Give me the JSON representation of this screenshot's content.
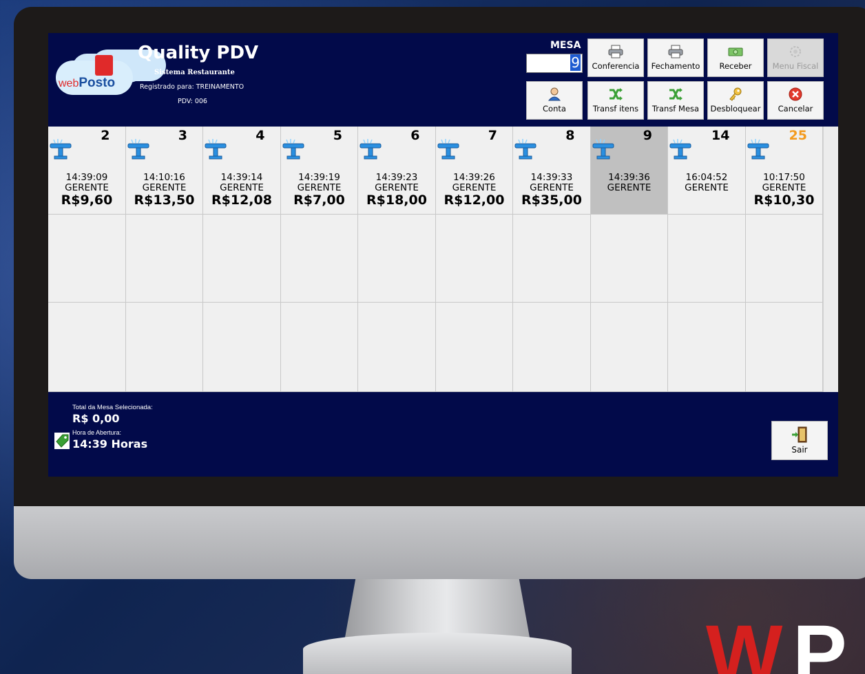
{
  "header": {
    "app_title": "Quality PDV",
    "subtitle": "Sistema Restaurante",
    "registered": "Registrado para: TREINAMENTO",
    "pdv": "PDV: 006",
    "logo_text_web": "web",
    "logo_text_posto": "Posto",
    "mesa_label": "MESA",
    "mesa_value": "9"
  },
  "toolbar": {
    "conferencia": "Conferencia",
    "fechamento": "Fechamento",
    "receber": "Receber",
    "menu_fiscal": "Menu Fiscal",
    "conta": "Conta",
    "transf_itens": "Transf itens",
    "transf_mesa": "Transf Mesa",
    "desbloquear": "Desbloquear",
    "cancelar": "Cancelar"
  },
  "tables": [
    {
      "number": "2",
      "time": "14:39:09",
      "user": "GERENTE",
      "value": "R$9,60"
    },
    {
      "number": "3",
      "time": "14:10:16",
      "user": "GERENTE",
      "value": "R$13,50"
    },
    {
      "number": "4",
      "time": "14:39:14",
      "user": "GERENTE",
      "value": "R$12,08"
    },
    {
      "number": "5",
      "time": "14:39:19",
      "user": "GERENTE",
      "value": "R$7,00"
    },
    {
      "number": "6",
      "time": "14:39:23",
      "user": "GERENTE",
      "value": "R$18,00"
    },
    {
      "number": "7",
      "time": "14:39:26",
      "user": "GERENTE",
      "value": "R$12,00"
    },
    {
      "number": "8",
      "time": "14:39:33",
      "user": "GERENTE",
      "value": "R$35,00"
    },
    {
      "number": "9",
      "time": "14:39:36",
      "user": "GERENTE",
      "value": "",
      "selected": true
    },
    {
      "number": "14",
      "time": "16:04:52",
      "user": "GERENTE",
      "value": ""
    },
    {
      "number": "25",
      "time": "10:17:50",
      "user": "GERENTE",
      "value": "R$10,30",
      "number_color": "#f39a1e"
    }
  ],
  "footer": {
    "total_label": "Total da Mesa Selecionada:",
    "total_value": "R$ 0,00",
    "open_label": "Hora de Abertura:",
    "open_value": "14:39 Horas",
    "sair": "Sair"
  },
  "brand": {
    "w": "W",
    "p": "P"
  },
  "colors": {
    "screen_bg": "#020a4a",
    "grid_bg": "#f0f0f0",
    "selected_cell": "#c0c0c0",
    "highlight_number": "#f39a1e",
    "brand_red": "#d5201e"
  }
}
